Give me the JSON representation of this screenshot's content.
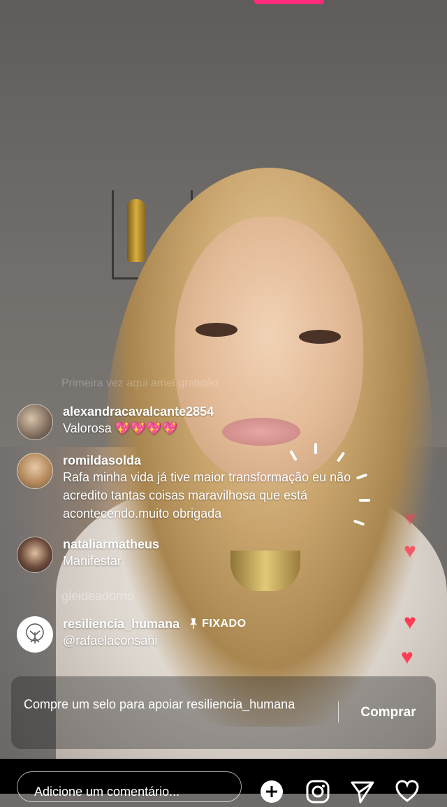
{
  "comments": [
    {
      "username": "alexandracavalcante2854",
      "text": "Valorosa 💖💖💖💖"
    },
    {
      "username": "romildasolda",
      "text": "Rafa minha vida já tive maior transformação eu não acredito tantas coisas maravilhosa que está acontecendo.muito obrigada"
    },
    {
      "username": "nataliarmatheus",
      "text": "Manifestar"
    }
  ],
  "faded": {
    "comment": "Primeira vez aqui amei gratidão",
    "username": "gleideadorno"
  },
  "pinned": {
    "username": "resiliencia_humana",
    "label": "FIXADO",
    "text": "@rafaelaconsani"
  },
  "support": {
    "text": "Compre um selo para apoiar resiliencia_humana",
    "button": "Comprar"
  },
  "composer": {
    "placeholder": "Adicione um comentário..."
  },
  "icons": [
    "pin-icon",
    "add-icon",
    "instagram-icon",
    "send-icon",
    "heart-icon"
  ],
  "colors": {
    "accent": "#ff2b7a",
    "hearts": "#ff3d55"
  }
}
